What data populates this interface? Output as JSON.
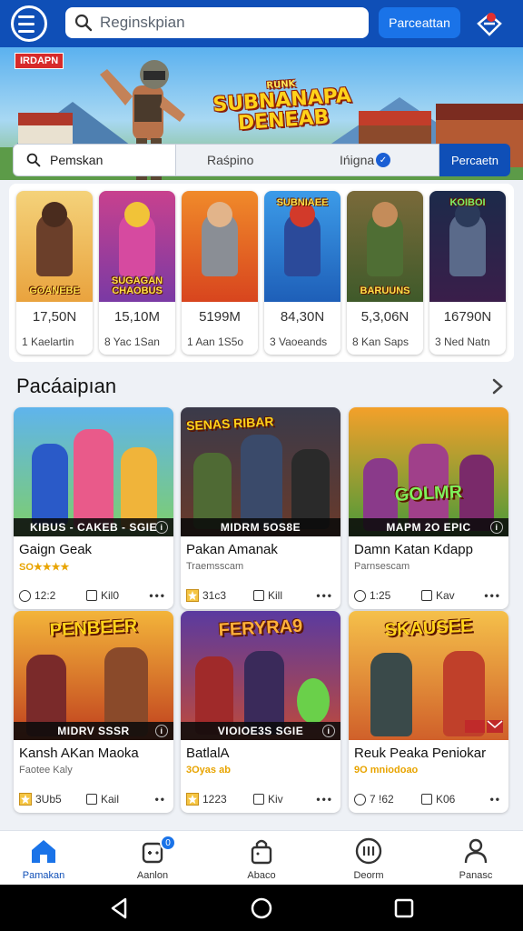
{
  "header": {
    "search_placeholder": "Reginskpian",
    "action_label": "Parceattan"
  },
  "hero": {
    "badge": "IRDAPN",
    "title": "SUBNANAPA DENEAB",
    "kicker": "RUNK"
  },
  "subbar": {
    "search_label": "Pemskan",
    "tab_1": "Raśpino",
    "tab_2": "Ińigna",
    "button": "Percaetn"
  },
  "top_games": [
    {
      "title": "GOANEBE",
      "size": "17,50N",
      "rating": "1 Kaelartin"
    },
    {
      "title": "SUGAGAN CHAOBUS",
      "size": "15,10M",
      "rating": "8 Yac 1San"
    },
    {
      "title": "",
      "size": "5199M",
      "rating": "1 Aan 1S5o"
    },
    {
      "title": "SUBNIAEE",
      "size": "84,30N",
      "rating": "3 Vaoeands"
    },
    {
      "title": "BARUUNS",
      "size": "5,3,06N",
      "rating": "8 Kan Saps"
    },
    {
      "title": "KOIBOI",
      "size": "16790N",
      "rating": "3 Ned Natn"
    }
  ],
  "section": {
    "title": "Pacáaipıan"
  },
  "grid_games": [
    {
      "art_title": "",
      "strip": "KIBUS - CAKEB - SGIE",
      "title": "Gaign Geak",
      "sub": "SO★★★★",
      "stat1": "12:2",
      "stat2": "Kil0",
      "sub_is_stars": true
    },
    {
      "art_title": "SENAS RIBAR",
      "strip": "MIDRM 5OS8E",
      "title": "Pakan Amanak",
      "sub": "Traemsscam",
      "stat1": "31c3",
      "stat2": "Kill",
      "sub_is_stars": false
    },
    {
      "art_title": "GOLMR",
      "strip": "MAPM 2O EPIC",
      "title": "Damn Katan Kdapp",
      "sub": "Parnsescam",
      "stat1": "1:25",
      "stat2": "Kav",
      "sub_is_stars": false
    },
    {
      "art_title": "PENBEER",
      "strip": "MIDRV SSSR",
      "title": "Kansh AKan Maoka",
      "sub": "Faotee Kaly",
      "stat1": "3Ub5",
      "stat2": "Kail",
      "sub_is_stars": false
    },
    {
      "art_title": "FERYRA9",
      "strip": "VIOIOE3S SGIE",
      "title": "BatlalA",
      "sub": "3Oyas ab",
      "stat1": "1223",
      "stat2": "Kiv",
      "sub_is_stars": true
    },
    {
      "art_title": "SKAUSEE",
      "strip": "",
      "title": "Reuk Peaka Peniokar",
      "sub": "9O mniodoao",
      "stat1": "7 !62",
      "stat2": "K06",
      "sub_is_stars": true
    }
  ],
  "bottom_nav": [
    {
      "label": "Pamakan",
      "icon": "home-icon"
    },
    {
      "label": "Aanlon",
      "icon": "gamepad-icon",
      "badge": "0"
    },
    {
      "label": "Abaco",
      "icon": "bag-icon"
    },
    {
      "label": "Deorm",
      "icon": "list-circle-icon"
    },
    {
      "label": "Panasc",
      "icon": "profile-icon"
    }
  ],
  "colors": {
    "brand": "#0f4fb7",
    "accent": "#1a73e8",
    "badge_red": "#d72a2a",
    "star": "#e8a400"
  }
}
